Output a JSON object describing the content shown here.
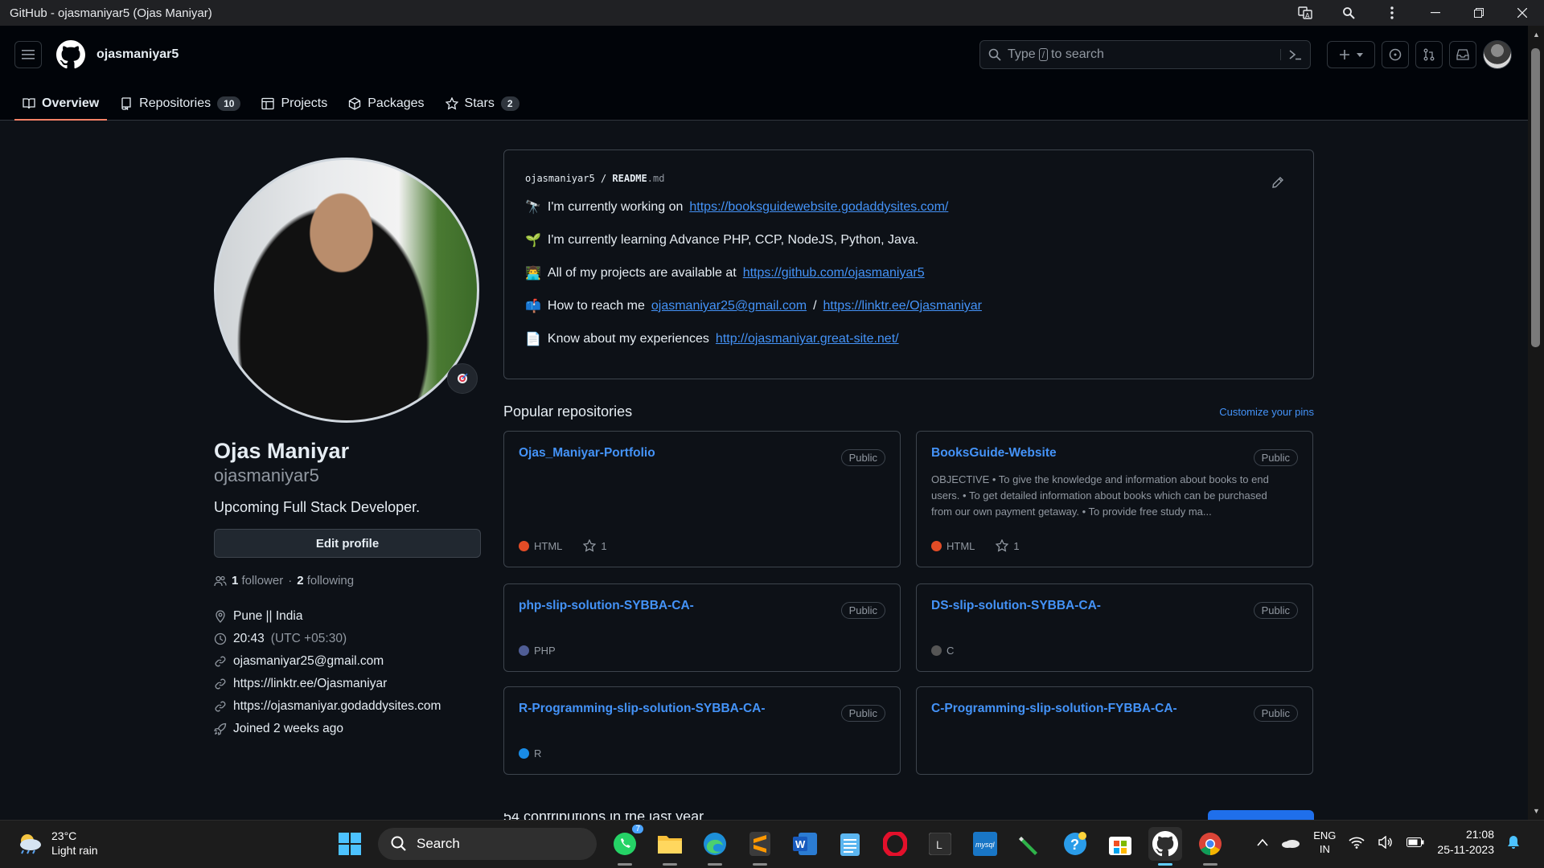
{
  "window": {
    "title": "GitHub - ojasmaniyar5 (Ojas Maniyar)"
  },
  "header": {
    "username": "ojasmaniyar5",
    "search_prefix": "Type",
    "search_key": "/",
    "search_suffix": "to search",
    "tabs": [
      {
        "label": "Overview",
        "icon": "book-icon"
      },
      {
        "label": "Repositories",
        "count": "10",
        "icon": "repo-icon"
      },
      {
        "label": "Projects",
        "icon": "table-icon"
      },
      {
        "label": "Packages",
        "icon": "package-icon"
      },
      {
        "label": "Stars",
        "count": "2",
        "icon": "star-icon"
      }
    ]
  },
  "profile": {
    "name": "Ojas Maniyar",
    "login": "ojasmaniyar5",
    "bio": "Upcoming Full Stack Developer.",
    "edit_label": "Edit profile",
    "followers": "1",
    "followers_label": "follower",
    "separator": "·",
    "following": "2",
    "following_label": "following",
    "location": "Pune || India",
    "time": "20:43",
    "tz": "(UTC +05:30)",
    "email": "ojasmaniyar25@gmail.com",
    "link1": "https://linktr.ee/Ojasmaniyar",
    "link2": "https://ojasmaniyar.godaddysites.com",
    "joined": "Joined 2 weeks ago"
  },
  "readme": {
    "owner": "ojasmaniyar5",
    "sep": "/",
    "file": "README",
    "ext": ".md",
    "lines": [
      {
        "emoji": "🔭",
        "text": "I'm currently working on",
        "link": "https://booksguidewebsite.godaddysites.com/"
      },
      {
        "emoji": "🌱",
        "text": "I'm currently learning Advance PHP, CCP, NodeJS, Python, Java."
      },
      {
        "emoji": "👨‍💻",
        "text": "All of my projects are available at",
        "link": "https://github.com/ojasmaniyar5"
      },
      {
        "emoji": "📫",
        "text": "How to reach me",
        "link": "ojasmaniyar25@gmail.com",
        "mid": "/",
        "link2": "https://linktr.ee/Ojasmaniyar"
      },
      {
        "emoji": "📄",
        "text": "Know about my experiences",
        "link": "http://ojasmaniyar.great-site.net/"
      }
    ]
  },
  "popular": {
    "title": "Popular repositories",
    "customize": "Customize your pins",
    "public_label": "Public",
    "repos": [
      {
        "name": "Ojas_Maniyar-Portfolio",
        "lang": "HTML",
        "color": "#e34c26",
        "stars": "1",
        "desc": ""
      },
      {
        "name": "BooksGuide-Website",
        "lang": "HTML",
        "color": "#e34c26",
        "stars": "1",
        "desc": "OBJECTIVE • To give the knowledge and information about books to end users. • To get detailed information about books which can be purchased from our own payment getaway. • To provide free study ma..."
      },
      {
        "name": "php-slip-solution-SYBBA-CA-",
        "lang": "PHP",
        "color": "#4F5D95"
      },
      {
        "name": "DS-slip-solution-SYBBA-CA-",
        "lang": "C",
        "color": "#555555"
      },
      {
        "name": "R-Programming-slip-solution-SYBBA-CA-",
        "lang": "R",
        "color": "#198CE7"
      },
      {
        "name": "C-Programming-slip-solution-FYBBA-CA-",
        "lang": "",
        "color": ""
      }
    ]
  },
  "contributions_partial": "54 contributions in the last year",
  "taskbar": {
    "temp": "23°C",
    "weather": "Light rain",
    "search": "Search",
    "whatsapp_badge": "7",
    "lang1": "ENG",
    "lang2": "IN",
    "time": "21:08",
    "date": "25-11-2023"
  }
}
